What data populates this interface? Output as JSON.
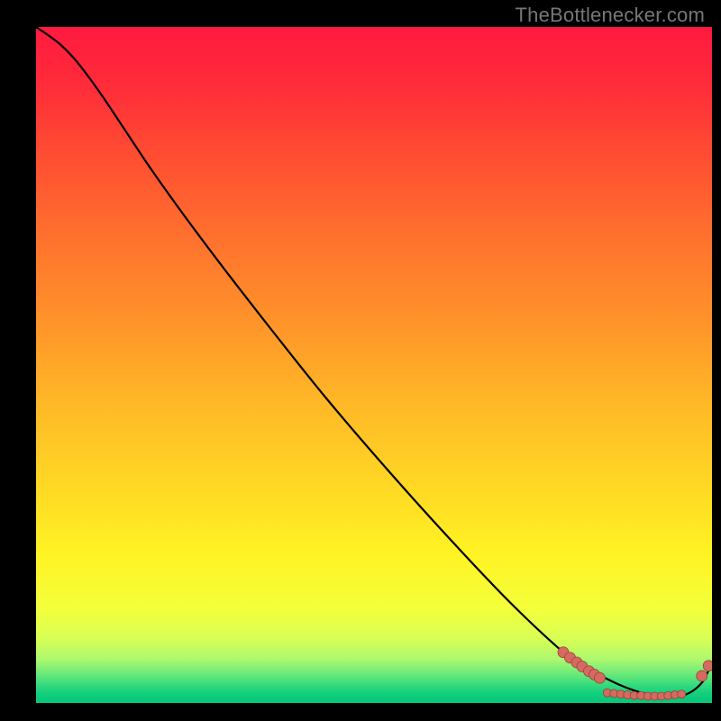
{
  "watermark": "TheBottlenecker.com",
  "colors": {
    "gradient_stops": [
      {
        "offset": 0.0,
        "color": "#ff1a3f"
      },
      {
        "offset": 0.08,
        "color": "#ff2a3a"
      },
      {
        "offset": 0.18,
        "color": "#ff4a33"
      },
      {
        "offset": 0.3,
        "color": "#ff6e2e"
      },
      {
        "offset": 0.42,
        "color": "#ff8f2a"
      },
      {
        "offset": 0.55,
        "color": "#ffb627"
      },
      {
        "offset": 0.68,
        "color": "#ffd824"
      },
      {
        "offset": 0.78,
        "color": "#fff324"
      },
      {
        "offset": 0.86,
        "color": "#f3ff3a"
      },
      {
        "offset": 0.905,
        "color": "#d8ff55"
      },
      {
        "offset": 0.935,
        "color": "#aef86e"
      },
      {
        "offset": 0.958,
        "color": "#67e97a"
      },
      {
        "offset": 0.975,
        "color": "#30d97d"
      },
      {
        "offset": 0.986,
        "color": "#12cf7d"
      },
      {
        "offset": 0.994,
        "color": "#0bc97b"
      },
      {
        "offset": 1.0,
        "color": "#09c87a"
      }
    ],
    "curve": "#000000",
    "marker_fill": "#d46a60",
    "marker_stroke": "#9c3f38"
  },
  "chart_data": {
    "type": "line",
    "title": "",
    "xlabel": "",
    "ylabel": "",
    "xlim": [
      0,
      1
    ],
    "ylim": [
      0,
      1
    ],
    "series": [
      {
        "name": "bottleneck-curve",
        "x": [
          0.0,
          0.015,
          0.035,
          0.055,
          0.075,
          0.1,
          0.13,
          0.17,
          0.22,
          0.28,
          0.35,
          0.43,
          0.52,
          0.61,
          0.7,
          0.78,
          0.81,
          0.84,
          0.87,
          0.9,
          0.93,
          0.96,
          0.985,
          1.0
        ],
        "y": [
          1.0,
          0.99,
          0.975,
          0.955,
          0.93,
          0.895,
          0.85,
          0.79,
          0.72,
          0.64,
          0.55,
          0.45,
          0.345,
          0.245,
          0.15,
          0.075,
          0.055,
          0.038,
          0.024,
          0.014,
          0.01,
          0.012,
          0.03,
          0.06
        ]
      }
    ],
    "markers": [
      {
        "name": "cluster-left",
        "points": [
          {
            "x": 0.78,
            "y": 0.075
          },
          {
            "x": 0.79,
            "y": 0.067
          },
          {
            "x": 0.8,
            "y": 0.06
          },
          {
            "x": 0.808,
            "y": 0.054
          },
          {
            "x": 0.818,
            "y": 0.047
          },
          {
            "x": 0.826,
            "y": 0.042
          },
          {
            "x": 0.834,
            "y": 0.037
          }
        ],
        "size": 6
      },
      {
        "name": "cluster-bottom",
        "points": [
          {
            "x": 0.845,
            "y": 0.015
          },
          {
            "x": 0.855,
            "y": 0.014
          },
          {
            "x": 0.865,
            "y": 0.013
          },
          {
            "x": 0.875,
            "y": 0.012
          },
          {
            "x": 0.885,
            "y": 0.011
          },
          {
            "x": 0.895,
            "y": 0.011
          },
          {
            "x": 0.905,
            "y": 0.01
          },
          {
            "x": 0.915,
            "y": 0.01
          },
          {
            "x": 0.925,
            "y": 0.01
          },
          {
            "x": 0.935,
            "y": 0.011
          },
          {
            "x": 0.945,
            "y": 0.012
          },
          {
            "x": 0.955,
            "y": 0.013
          }
        ],
        "size": 4.5
      },
      {
        "name": "cluster-right",
        "points": [
          {
            "x": 0.985,
            "y": 0.04
          },
          {
            "x": 0.995,
            "y": 0.055
          }
        ],
        "size": 6
      }
    ]
  }
}
